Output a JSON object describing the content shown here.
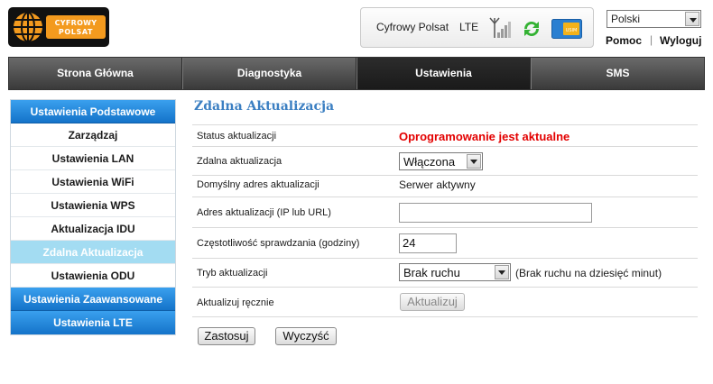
{
  "header": {
    "logo_text_line1": "CYFROWY",
    "logo_text_line2": "POLSAT",
    "operator": "Cyfrowy Polsat",
    "network": "LTE",
    "sim_label": "USIM",
    "language_selected": "Polski",
    "help_label": "Pomoc",
    "separator": "|",
    "logout_label": "Wyloguj"
  },
  "topnav": {
    "tabs": [
      "Strona Główna",
      "Diagnostyka",
      "Ustawienia",
      "SMS"
    ],
    "active": "Ustawienia"
  },
  "sidebar": {
    "items": [
      {
        "label": "Ustawienia Podstawowe"
      },
      {
        "label": "Zarządzaj"
      },
      {
        "label": "Ustawienia LAN"
      },
      {
        "label": "Ustawienia WiFi"
      },
      {
        "label": "Ustawienia WPS"
      },
      {
        "label": "Aktualizacja IDU"
      },
      {
        "label": "Zdalna Aktualizacja"
      },
      {
        "label": "Ustawienia ODU"
      },
      {
        "label": "Ustawienia Zaawansowane"
      },
      {
        "label": "Ustawienia LTE"
      }
    ],
    "selected": "Zdalna Aktualizacja"
  },
  "main": {
    "title": "Zdalna Aktualizacja",
    "rows": {
      "status": {
        "label": "Status aktualizacji",
        "value": "Oprogramowanie jest aktualne"
      },
      "remote": {
        "label": "Zdalna aktualizacja",
        "value": "Włączona"
      },
      "default_address": {
        "label": "Domyślny adres aktualizacji",
        "value": "Serwer aktywny"
      },
      "address": {
        "label": "Adres aktualizacji (IP lub URL)",
        "value": ""
      },
      "frequency": {
        "label": "Częstotliwość sprawdzania (godziny)",
        "value": "24"
      },
      "mode": {
        "label": "Tryb aktualizacji",
        "value": "Brak ruchu",
        "hint": "(Brak ruchu na dziesięć minut)"
      },
      "manual": {
        "label": "Aktualizuj ręcznie",
        "button": "Aktualizuj"
      }
    },
    "apply_label": "Zastosuj",
    "clear_label": "Wyczyść"
  },
  "colors": {
    "status_ok": "#e30000",
    "sidebar_blue": "#1473c9",
    "sidebar_selected": "#a3dcf2",
    "title_blue": "#3b7fc2",
    "brand_orange": "#f39a1e"
  }
}
